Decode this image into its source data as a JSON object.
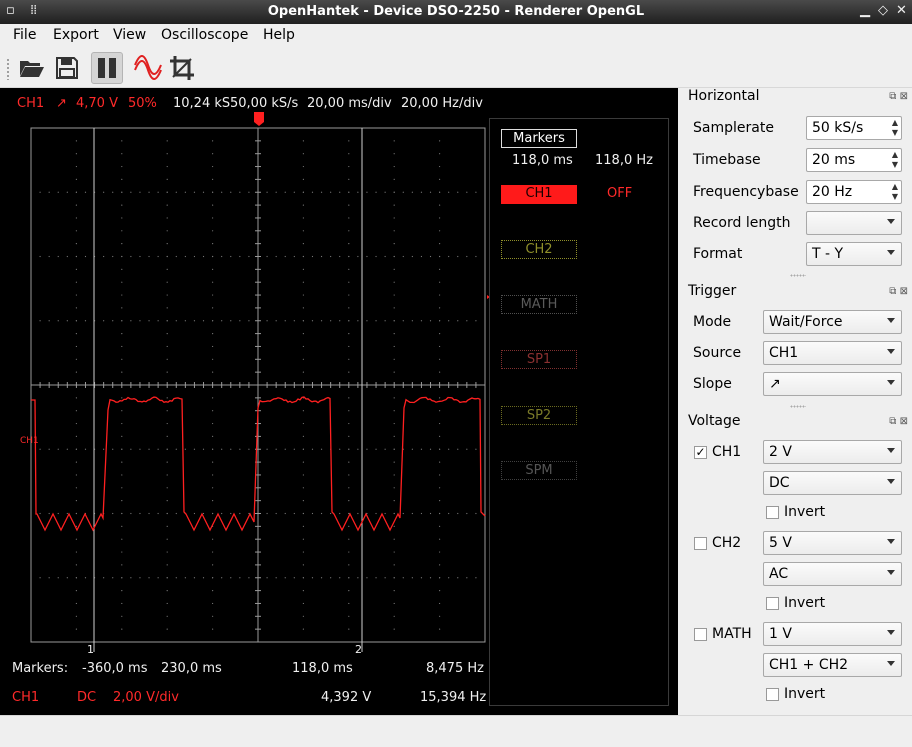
{
  "window": {
    "title": "OpenHantek - Device DSO-2250 - Renderer OpenGL"
  },
  "menu": {
    "file": "File",
    "export": "Export",
    "view": "View",
    "oscilloscope": "Oscilloscope",
    "help": "Help"
  },
  "scope": {
    "ch_label": "CH1",
    "trigger_slope": "↗",
    "trigger_level": "4,70 V",
    "trigger_pos": "50%",
    "record": "10,24 kS",
    "samplerate": "50,00 kS/s",
    "timebase": "20,00 ms/div",
    "freqbase": "20,00 Hz/div",
    "side_ch_label": "CH1",
    "marker1": "1",
    "marker2": "2",
    "markers_title": "Markers",
    "marker_time": "118,0 ms",
    "marker_freq": "118,0 Hz",
    "btn_ch1": "CH1",
    "btn_off": "OFF",
    "btn_ch2": "CH2",
    "btn_math": "MATH",
    "btn_sp1": "SP1",
    "btn_sp2": "SP2",
    "btn_spm": "SPM",
    "bottom": {
      "markers_label": "Markers:",
      "m1": "-360,0 ms",
      "m2": "230,0 ms",
      "delta": "118,0 ms",
      "freq": "8,475 Hz",
      "ch": "CH1",
      "coupling": "DC",
      "vdiv": "2,00 V/div",
      "voltage": "4,392 V",
      "ch_freq": "15,394 Hz"
    }
  },
  "horizontal": {
    "title": "Horizontal",
    "samplerate_label": "Samplerate",
    "samplerate": "50 kS/s",
    "timebase_label": "Timebase",
    "timebase": "20 ms",
    "freqbase_label": "Frequencybase",
    "freqbase": "20 Hz",
    "record_label": "Record length",
    "record": "",
    "format_label": "Format",
    "format": "T - Y"
  },
  "trigger": {
    "title": "Trigger",
    "mode_label": "Mode",
    "mode": "Wait/Force",
    "source_label": "Source",
    "source": "CH1",
    "slope_label": "Slope",
    "slope": "↗"
  },
  "voltage": {
    "title": "Voltage",
    "ch1": {
      "label": "CH1",
      "checked": "✓",
      "gain": "2 V",
      "coupling": "DC",
      "invert": "Invert"
    },
    "ch2": {
      "label": "CH2",
      "gain": "5 V",
      "coupling": "AC",
      "invert": "Invert"
    },
    "math": {
      "label": "MATH",
      "gain": "1 V",
      "mode": "CH1 + CH2",
      "invert": "Invert"
    }
  },
  "colors": {
    "ch1": "#ff2020",
    "ch2": "#8f8f2a",
    "math": "#505050",
    "sp1": "#803030",
    "grid": "#9a9a9a"
  }
}
